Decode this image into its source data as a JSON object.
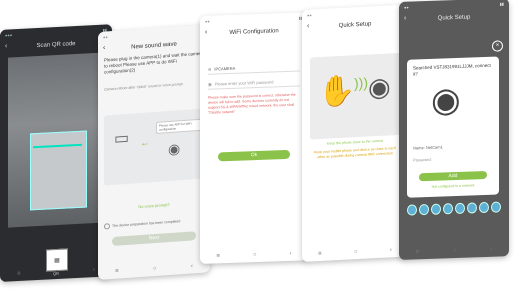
{
  "screens": [
    {
      "title": "Scan QR code",
      "qr_button_label": "QR"
    },
    {
      "title": "New sound wave",
      "description": "Please plug in the camera(1) and wait the camera to reboot Please use APP to do WiFi configuration(2)",
      "hint": "Camera reboot after \"dididi\" sound or voice prompt",
      "bubble": "Please use APP for WiFi configuration",
      "no_prompt_link": "No voice prompt?",
      "checkbox_label": "The device preparation has been completed",
      "next_button": "Next"
    },
    {
      "title": "WiFi Configuration",
      "wifi_value": "IPCAMERA",
      "password_placeholder": "Please enter your WiFi password",
      "warning": "Please make sure the password is correct, otherwise the device will fail to add. Some devices currently do not support 5G & WPA/WPA2 mixed network, the user shall \"Disable network\"",
      "ok_button": "Ok"
    },
    {
      "title": "Quick Setup",
      "beep_text": "Keep the phone close to the camera",
      "keep_text": "Keep your mobile phone and device as close to each other as possible during camera WiFi connection"
    },
    {
      "title": "Quick Setup",
      "found_text": "Searched VSTJ831991LJJJM, connect it?",
      "name_label": "Name: NetCam1",
      "password_label": "Password:",
      "add_button": "Add",
      "no_connect_link": "Not configured to a network"
    }
  ],
  "icons": {
    "back": "back-arrow-icon",
    "close": "close-icon",
    "wifi": "wifi-icon",
    "lock": "lock-icon",
    "camera": "camera-icon",
    "qr": "qr-code-icon"
  },
  "colors": {
    "accent": "#8bc34a",
    "warning": "#e25a5a",
    "dialog_dot": "#5fb0d6"
  }
}
